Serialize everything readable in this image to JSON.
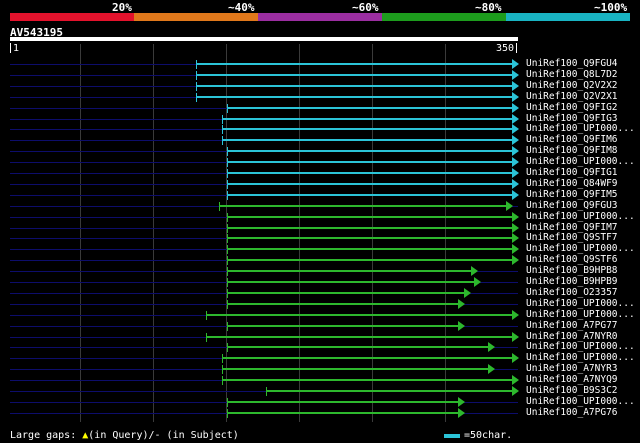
{
  "colors": {
    "band": [
      "#e3122c",
      "#e0781b",
      "#9b2ea1",
      "#1d9c1d",
      "#19b3c2"
    ],
    "cyan": "#2bc4d8",
    "green": "#2db82d",
    "track": "#0d0d6b"
  },
  "percent_labels": [
    "20%",
    "~40%",
    "~60%",
    "~80%",
    "~100%"
  ],
  "query": {
    "title": "AV543195",
    "start": "1",
    "end": "350"
  },
  "hits": [
    {
      "label": "UniRef100_Q9FGU4",
      "color": "cyan",
      "start": 0.366,
      "end": 1.0
    },
    {
      "label": "UniRef100_Q8L7D2",
      "color": "cyan",
      "start": 0.366,
      "end": 1.0
    },
    {
      "label": "UniRef100_Q2V2X2",
      "color": "cyan",
      "start": 0.366,
      "end": 1.0
    },
    {
      "label": "UniRef100_Q2V2X1",
      "color": "cyan",
      "start": 0.366,
      "end": 1.0
    },
    {
      "label": "UniRef100_Q9FIG2",
      "color": "cyan",
      "start": 0.428,
      "end": 1.0
    },
    {
      "label": "UniRef100_Q9FIG3",
      "color": "cyan",
      "start": 0.417,
      "end": 1.0
    },
    {
      "label": "UniRef100_UPI000...",
      "color": "cyan",
      "start": 0.417,
      "end": 1.0
    },
    {
      "label": "UniRef100_Q9FIM6",
      "color": "cyan",
      "start": 0.417,
      "end": 1.0
    },
    {
      "label": "UniRef100_Q9FIM8",
      "color": "cyan",
      "start": 0.428,
      "end": 1.0
    },
    {
      "label": "UniRef100_UPI000...",
      "color": "cyan",
      "start": 0.428,
      "end": 1.0
    },
    {
      "label": "UniRef100_Q9FIG1",
      "color": "cyan",
      "start": 0.428,
      "end": 1.0
    },
    {
      "label": "UniRef100_Q84WF9",
      "color": "cyan",
      "start": 0.428,
      "end": 1.0
    },
    {
      "label": "UniRef100_Q9FIM5",
      "color": "cyan",
      "start": 0.428,
      "end": 1.0
    },
    {
      "label": "UniRef100_Q9FGU3",
      "color": "green",
      "start": 0.411,
      "end": 0.988
    },
    {
      "label": "UniRef100_UPI000...",
      "color": "green",
      "start": 0.428,
      "end": 1.0
    },
    {
      "label": "UniRef100_Q9FIM7",
      "color": "green",
      "start": 0.428,
      "end": 1.0
    },
    {
      "label": "UniRef100_Q9STF7",
      "color": "green",
      "start": 0.428,
      "end": 1.0
    },
    {
      "label": "UniRef100_UPI000...",
      "color": "green",
      "start": 0.428,
      "end": 1.0
    },
    {
      "label": "UniRef100_Q9STF6",
      "color": "green",
      "start": 0.428,
      "end": 1.0
    },
    {
      "label": "UniRef100_B9HPB8",
      "color": "green",
      "start": 0.428,
      "end": 0.919
    },
    {
      "label": "UniRef100_B9HPB9",
      "color": "green",
      "start": 0.428,
      "end": 0.925
    },
    {
      "label": "UniRef100_O23357",
      "color": "green",
      "start": 0.428,
      "end": 0.905
    },
    {
      "label": "UniRef100_UPI000...",
      "color": "green",
      "start": 0.428,
      "end": 0.894
    },
    {
      "label": "UniRef100_UPI000...",
      "color": "green",
      "start": 0.385,
      "end": 1.0
    },
    {
      "label": "UniRef100_A7PG77",
      "color": "green",
      "start": 0.428,
      "end": 0.894
    },
    {
      "label": "UniRef100_A7NYR0",
      "color": "green",
      "start": 0.385,
      "end": 1.0
    },
    {
      "label": "UniRef100_UPI000...",
      "color": "green",
      "start": 0.428,
      "end": 0.953
    },
    {
      "label": "UniRef100_UPI000...",
      "color": "green",
      "start": 0.417,
      "end": 1.0
    },
    {
      "label": "UniRef100_A7NYR3",
      "color": "green",
      "start": 0.417,
      "end": 0.953
    },
    {
      "label": "UniRef100_A7NYQ9",
      "color": "green",
      "start": 0.417,
      "end": 1.0
    },
    {
      "label": "UniRef100_B9S3C2",
      "color": "green",
      "start": 0.504,
      "end": 1.0
    },
    {
      "label": "UniRef100_UPI000...",
      "color": "green",
      "start": 0.428,
      "end": 0.894
    },
    {
      "label": "UniRef100_A7PG76",
      "color": "green",
      "start": 0.428,
      "end": 0.894
    }
  ],
  "legend": {
    "left": "Large gaps: ",
    "query_mark": "▲",
    "left_rest": "(in Query)/- (in Subject)",
    "right": "=50char."
  }
}
